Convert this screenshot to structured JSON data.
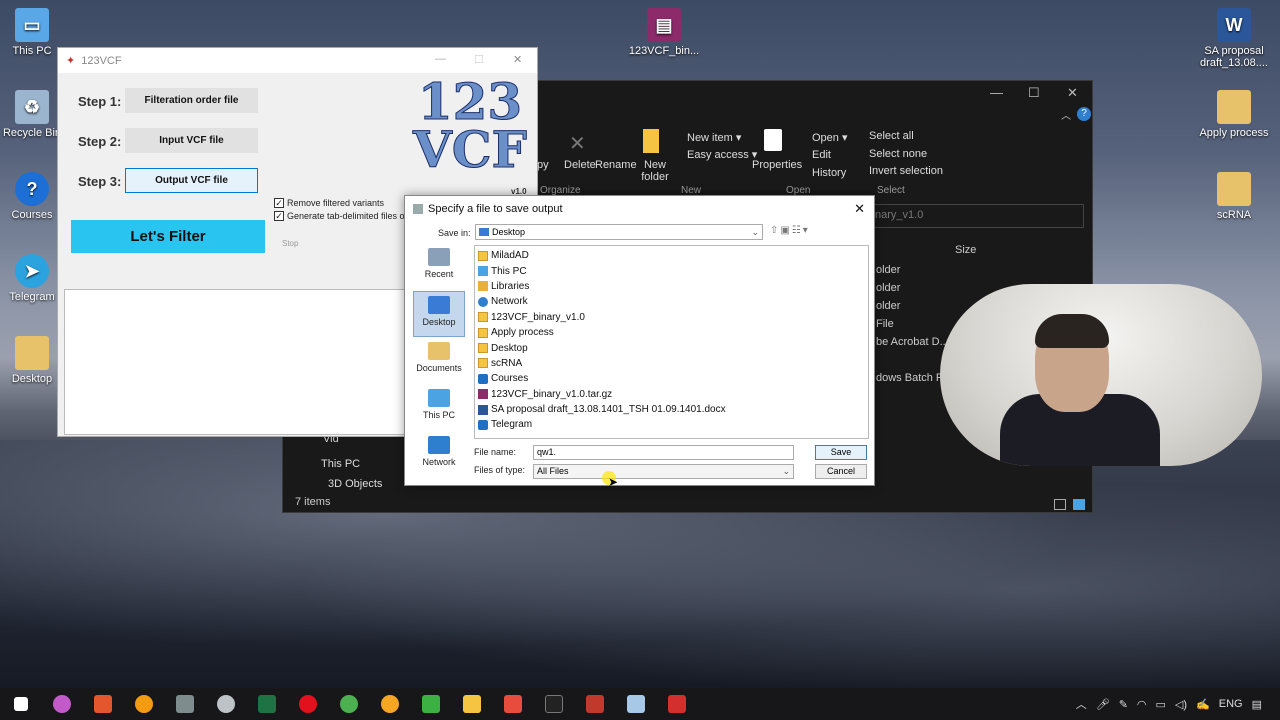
{
  "desktop": {
    "icons": [
      {
        "label": "This PC",
        "icon": "this-pc-icon",
        "color": "#5aa7e8"
      },
      {
        "label": "Recycle Bin",
        "icon": "recycle-bin-icon",
        "color": "#9bb5cf"
      },
      {
        "label": "Courses",
        "icon": "help-icon",
        "color": "#1d6fd6"
      },
      {
        "label": "Telegram",
        "icon": "telegram-icon",
        "color": "#2aa3df"
      },
      {
        "label": "Desktop",
        "icon": "folder-icon",
        "color": "#e8c26a"
      },
      {
        "label": "123VCF_bin...",
        "icon": "winrar-icon",
        "color": "#8d2b6a"
      },
      {
        "label": "SA proposal draft_13.08....",
        "icon": "word-icon",
        "color": "#2b579a"
      },
      {
        "label": "Apply process",
        "icon": "folder-icon",
        "color": "#e8c26a"
      },
      {
        "label": "scRNA",
        "icon": "folder-icon",
        "color": "#e8c26a"
      }
    ]
  },
  "explorer": {
    "ribbon": {
      "copy": "py",
      "delete": "Delete",
      "rename": "Rename",
      "new_folder": "New folder",
      "new_item": "New item ▾",
      "easy_access": "Easy access ▾",
      "properties": "Properties",
      "open": "Open ▾",
      "edit": "Edit",
      "history": "History",
      "select_all": "Select all",
      "select_none": "Select none",
      "invert_selection": "Invert selection"
    },
    "groups": {
      "organize": "Organize",
      "new": "New",
      "open": "Open",
      "select": "Select"
    },
    "address": "nary_v1.0",
    "size_header": "Size",
    "rows": [
      "older",
      "older",
      "older",
      "File",
      "be Acrobat D...",
      "dows Batch File"
    ],
    "nav": {
      "vid": "Vid",
      "this_pc": "This PC",
      "objects": "3D Objects"
    },
    "status": "7 items"
  },
  "app": {
    "title": "123VCF",
    "steps": [
      {
        "label": "Step 1:",
        "button": "Filteration order file"
      },
      {
        "label": "Step 2:",
        "button": "Input VCF file"
      },
      {
        "label": "Step 3:",
        "button": "Output VCF file"
      }
    ],
    "filter_button": "Let's Filter",
    "stop": "Stop",
    "checkboxes": [
      "Remove filtered variants",
      "Generate tab-delimited files of"
    ],
    "logo_line1": "123",
    "logo_line2": "VCF",
    "version": "v1.0"
  },
  "dialog": {
    "title": "Specify a file to save output",
    "save_in_label": "Save in:",
    "save_in_value": "Desktop",
    "places": [
      {
        "label": "Recent",
        "icon": "recent-icon",
        "color": "#8aa0b8"
      },
      {
        "label": "Desktop",
        "icon": "desktop-icon",
        "color": "#3a7bd5"
      },
      {
        "label": "Documents",
        "icon": "documents-icon",
        "color": "#e8c26a"
      },
      {
        "label": "This PC",
        "icon": "this-pc-icon",
        "color": "#4ba3e3"
      },
      {
        "label": "Network",
        "icon": "network-icon",
        "color": "#2f7fd1"
      }
    ],
    "files": [
      {
        "name": "MiladAD",
        "type": "folder"
      },
      {
        "name": "This PC",
        "type": "pc"
      },
      {
        "name": "Libraries",
        "type": "lib"
      },
      {
        "name": "Network",
        "type": "net"
      },
      {
        "name": "123VCF_binary_v1.0",
        "type": "folder"
      },
      {
        "name": "Apply process",
        "type": "folder"
      },
      {
        "name": "Desktop",
        "type": "folder"
      },
      {
        "name": "scRNA",
        "type": "folder"
      },
      {
        "name": "Courses",
        "type": "lnk"
      },
      {
        "name": "123VCF_binary_v1.0.tar.gz",
        "type": "zip"
      },
      {
        "name": "SA proposal draft_13.08.1401_TSH 01.09.1401.docx",
        "type": "doc"
      },
      {
        "name": "Telegram",
        "type": "lnk"
      }
    ],
    "file_name_label": "File name:",
    "file_name_value": "qw1.",
    "file_type_label": "Files of type:",
    "file_type_value": "All Files",
    "save_button": "Save",
    "cancel_button": "Cancel"
  },
  "taskbar": {
    "apps": [
      {
        "name": "start-button",
        "color": "#ffffff"
      },
      {
        "name": "app-pink-icon",
        "color": "#c25bc9"
      },
      {
        "name": "app-s-icon",
        "color": "#e4572e"
      },
      {
        "name": "search-icon",
        "color": "#f39c12"
      },
      {
        "name": "calculator-icon",
        "color": "#7f8c8d"
      },
      {
        "name": "cloud-icon",
        "color": "#bdc3c7"
      },
      {
        "name": "excel-icon",
        "color": "#1f7244"
      },
      {
        "name": "opera-icon",
        "color": "#e3101e"
      },
      {
        "name": "chrome-icon",
        "color": "#4caf50"
      },
      {
        "name": "app-q-icon",
        "color": "#f5a623"
      },
      {
        "name": "app-c-icon",
        "color": "#3cb043"
      },
      {
        "name": "file-explorer-icon",
        "color": "#f5c542"
      },
      {
        "name": "app-red-icon",
        "color": "#e74c3c"
      },
      {
        "name": "terminal-icon",
        "color": "#222222"
      },
      {
        "name": "app-123vcf-icon",
        "color": "#c0392b"
      },
      {
        "name": "notes-icon",
        "color": "#a8c8e8"
      },
      {
        "name": "acrobat-icon",
        "color": "#d32f2f"
      }
    ],
    "language": "ENG"
  }
}
